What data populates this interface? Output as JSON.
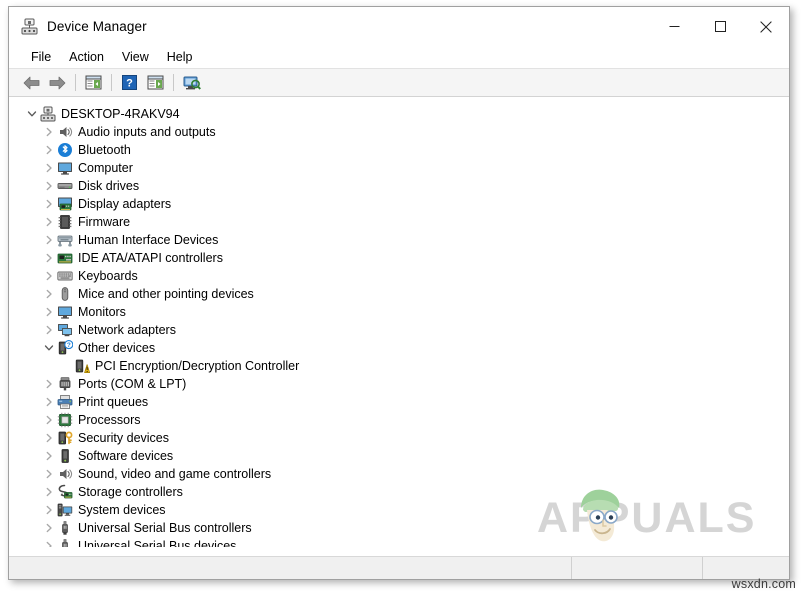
{
  "window": {
    "title": "Device Manager",
    "title_icon": "device-manager-icon",
    "controls": {
      "minimize": "minimize-icon",
      "maximize": "maximize-icon",
      "close": "close-icon"
    }
  },
  "menubar": {
    "items": [
      {
        "label": "File"
      },
      {
        "label": "Action"
      },
      {
        "label": "View"
      },
      {
        "label": "Help"
      }
    ]
  },
  "toolbar": {
    "buttons": [
      {
        "name": "back-arrow-icon",
        "title": "Back"
      },
      {
        "name": "forward-arrow-icon",
        "title": "Forward"
      },
      {
        "name": "separator"
      },
      {
        "name": "show-hide-console-tree-icon",
        "title": "Show/Hide Console Tree"
      },
      {
        "name": "separator"
      },
      {
        "name": "help-icon",
        "title": "Help"
      },
      {
        "name": "properties-icon",
        "title": "Properties"
      },
      {
        "name": "separator"
      },
      {
        "name": "scan-for-hardware-changes-icon",
        "title": "Scan for hardware changes"
      }
    ]
  },
  "tree": {
    "root": {
      "label": "DESKTOP-4RAKV94",
      "icon": "computer-tower-icon",
      "expanded": true
    },
    "items": [
      {
        "label": "Audio inputs and outputs",
        "icon": "speaker-icon",
        "expanded": false,
        "level": 1
      },
      {
        "label": "Bluetooth",
        "icon": "bluetooth-icon",
        "expanded": false,
        "level": 1
      },
      {
        "label": "Computer",
        "icon": "monitor-icon",
        "expanded": false,
        "level": 1
      },
      {
        "label": "Disk drives",
        "icon": "disk-drive-icon",
        "expanded": false,
        "level": 1
      },
      {
        "label": "Display adapters",
        "icon": "display-adapter-icon",
        "expanded": false,
        "level": 1
      },
      {
        "label": "Firmware",
        "icon": "firmware-chip-icon",
        "expanded": false,
        "level": 1
      },
      {
        "label": "Human Interface Devices",
        "icon": "hid-icon",
        "expanded": false,
        "level": 1
      },
      {
        "label": "IDE ATA/ATAPI controllers",
        "icon": "ide-controller-icon",
        "expanded": false,
        "level": 1
      },
      {
        "label": "Keyboards",
        "icon": "keyboard-icon",
        "expanded": false,
        "level": 1
      },
      {
        "label": "Mice and other pointing devices",
        "icon": "mouse-icon",
        "expanded": false,
        "level": 1
      },
      {
        "label": "Monitors",
        "icon": "monitor-icon",
        "expanded": false,
        "level": 1
      },
      {
        "label": "Network adapters",
        "icon": "network-adapter-icon",
        "expanded": false,
        "level": 1
      },
      {
        "label": "Other devices",
        "icon": "unknown-device-icon",
        "expanded": true,
        "level": 1
      },
      {
        "label": "PCI Encryption/Decryption Controller",
        "icon": "warning-device-icon",
        "expanded": null,
        "level": 2
      },
      {
        "label": "Ports (COM & LPT)",
        "icon": "port-connector-icon",
        "expanded": false,
        "level": 1
      },
      {
        "label": "Print queues",
        "icon": "printer-icon",
        "expanded": false,
        "level": 1
      },
      {
        "label": "Processors",
        "icon": "processor-icon",
        "expanded": false,
        "level": 1
      },
      {
        "label": "Security devices",
        "icon": "security-key-icon",
        "expanded": false,
        "level": 1
      },
      {
        "label": "Software devices",
        "icon": "software-device-icon",
        "expanded": false,
        "level": 1
      },
      {
        "label": "Sound, video and game controllers",
        "icon": "speaker-icon",
        "expanded": false,
        "level": 1
      },
      {
        "label": "Storage controllers",
        "icon": "storage-controller-icon",
        "expanded": false,
        "level": 1
      },
      {
        "label": "System devices",
        "icon": "system-device-icon",
        "expanded": false,
        "level": 1
      },
      {
        "label": "Universal Serial Bus controllers",
        "icon": "usb-icon",
        "expanded": false,
        "level": 1
      },
      {
        "label": "Universal Serial Bus devices",
        "icon": "usb-icon",
        "expanded": false,
        "level": 1
      }
    ]
  },
  "statusbar": {
    "panel1": "",
    "panel2": "",
    "panel3": ""
  },
  "watermark": {
    "text": "APPUALS",
    "color": "#d5d5d5"
  },
  "site_text": "wsxdn.com"
}
